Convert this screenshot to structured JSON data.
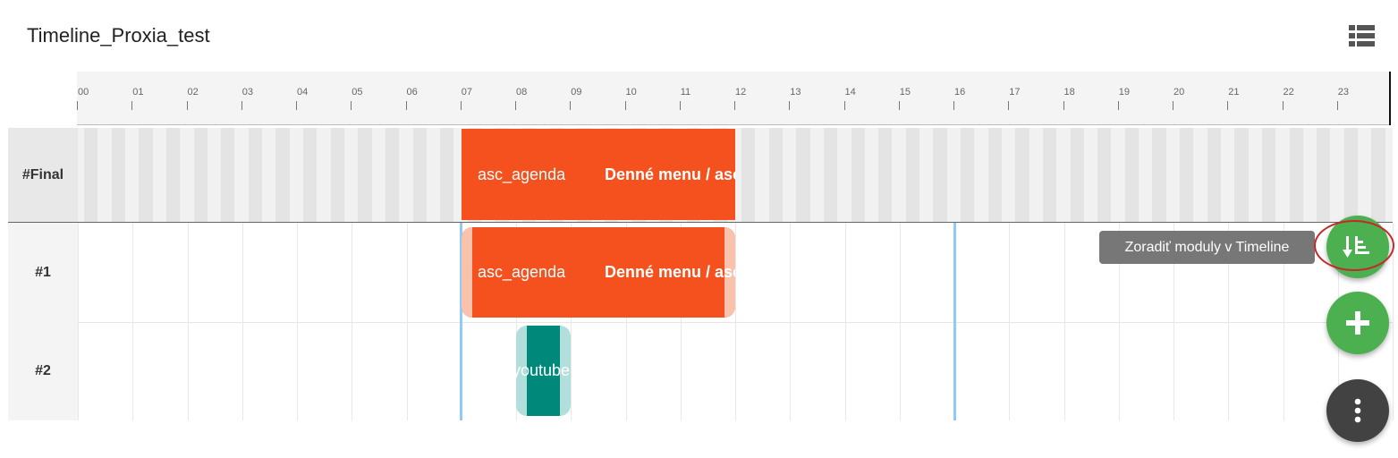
{
  "header": {
    "title": "Timeline_Proxia_test",
    "list_view_icon": "view-list-icon"
  },
  "ruler": {
    "hours": [
      "00",
      "01",
      "02",
      "03",
      "04",
      "05",
      "06",
      "07",
      "08",
      "09",
      "10",
      "11",
      "12",
      "13",
      "14",
      "15",
      "16",
      "17",
      "18",
      "19",
      "20",
      "21",
      "22",
      "23"
    ]
  },
  "tracks": [
    {
      "label": "#Final"
    },
    {
      "label": "#1"
    },
    {
      "label": "#2"
    }
  ],
  "modules": {
    "final": {
      "first": "asc_agenda",
      "second": "Denné menu / asc"
    },
    "track1": {
      "first": "asc_agenda",
      "second": "Denné menu / asc"
    },
    "track2": {
      "label": "youtube"
    }
  },
  "tooltip": {
    "text": "Zoradiť moduly v Timeline"
  },
  "fabs": {
    "sort_icon": "sort-icon",
    "add_icon": "plus-icon",
    "more_icon": "more-vertical-icon"
  },
  "colors": {
    "module": "#f4511e",
    "module_handle": "#f8c2ad",
    "youtube": "#00897b",
    "youtube_handle": "#b2dfdb",
    "fab_green": "#4caf50",
    "fab_dark": "#424242",
    "marker": "#90caf9"
  }
}
